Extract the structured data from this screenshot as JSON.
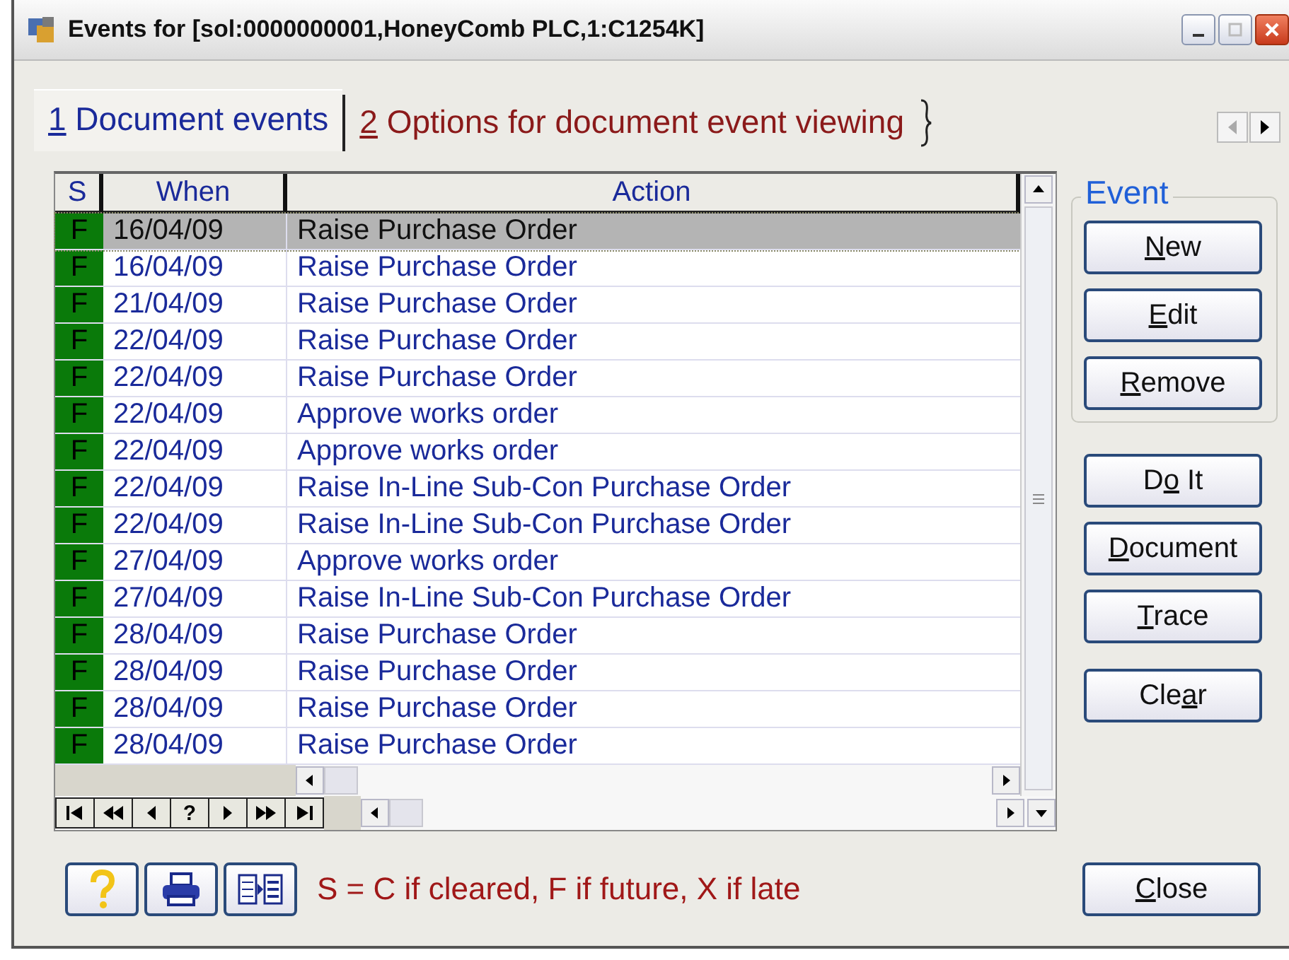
{
  "window": {
    "title": "Events for [sol:0000000001,HoneyComb PLC,1:C1254K]"
  },
  "tabs": [
    {
      "label": {
        "key": "1",
        "after": " Document events"
      },
      "selected": true
    },
    {
      "label": {
        "key": "2",
        "after": " Options for document event viewing"
      },
      "selected": false
    }
  ],
  "table": {
    "columns": [
      "S",
      "When",
      "Action"
    ],
    "rows": [
      {
        "s": "F",
        "when": "16/04/09",
        "action": "Raise Purchase Order",
        "selected": true
      },
      {
        "s": "F",
        "when": "16/04/09",
        "action": "Raise Purchase Order",
        "selected": false
      },
      {
        "s": "F",
        "when": "21/04/09",
        "action": "Raise Purchase Order",
        "selected": false
      },
      {
        "s": "F",
        "when": "22/04/09",
        "action": "Raise Purchase Order",
        "selected": false
      },
      {
        "s": "F",
        "when": "22/04/09",
        "action": "Raise Purchase Order",
        "selected": false
      },
      {
        "s": "F",
        "when": "22/04/09",
        "action": "Approve works order",
        "selected": false
      },
      {
        "s": "F",
        "when": "22/04/09",
        "action": "Approve works order",
        "selected": false
      },
      {
        "s": "F",
        "when": "22/04/09",
        "action": "Raise In-Line Sub-Con Purchase Order",
        "selected": false
      },
      {
        "s": "F",
        "when": "22/04/09",
        "action": "Raise In-Line Sub-Con Purchase Order",
        "selected": false
      },
      {
        "s": "F",
        "when": "27/04/09",
        "action": "Approve works order",
        "selected": false
      },
      {
        "s": "F",
        "when": "27/04/09",
        "action": "Raise In-Line Sub-Con Purchase Order",
        "selected": false
      },
      {
        "s": "F",
        "when": "28/04/09",
        "action": "Raise Purchase Order",
        "selected": false
      },
      {
        "s": "F",
        "when": "28/04/09",
        "action": "Raise Purchase Order",
        "selected": false
      },
      {
        "s": "F",
        "when": "28/04/09",
        "action": "Raise Purchase Order",
        "selected": false
      },
      {
        "s": "F",
        "when": "28/04/09",
        "action": "Raise Purchase Order",
        "selected": false
      }
    ]
  },
  "record_nav": {
    "query_label": "?"
  },
  "event_group": {
    "title": "Event",
    "buttons": [
      {
        "key": "N",
        "after": "ew"
      },
      {
        "key": "E",
        "after": "dit"
      },
      {
        "key": "R",
        "after": "emove"
      }
    ]
  },
  "action_buttons": [
    {
      "before": "D",
      "key": "o",
      "after": " It"
    },
    {
      "key": "D",
      "after": "ocument"
    },
    {
      "key": "T",
      "after": "race"
    }
  ],
  "clear_button": {
    "before": "Cle",
    "key": "a",
    "after": "r"
  },
  "legend": "S = C if cleared, F if future, X if late",
  "close_button": {
    "key": "C",
    "after": "lose"
  }
}
